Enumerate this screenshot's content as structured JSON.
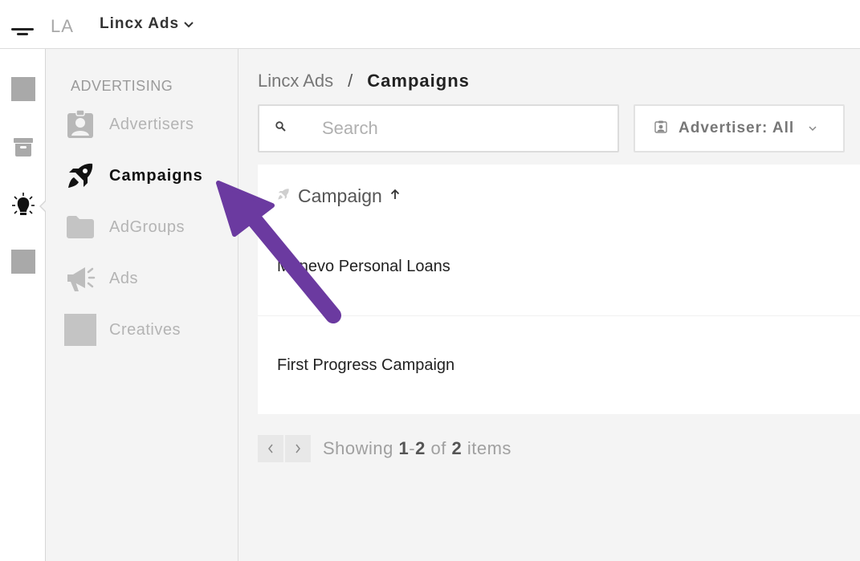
{
  "header": {
    "logo_initials": "LA",
    "app_name": "Lincx Ads",
    "menu_icon": "hamburger-icon"
  },
  "rail": {
    "items": [
      {
        "icon": "square-icon"
      },
      {
        "icon": "box-icon"
      },
      {
        "icon": "lightbulb-icon",
        "active": true
      },
      {
        "icon": "square-icon"
      }
    ]
  },
  "subnav": {
    "heading": "ADVERTISING",
    "items": [
      {
        "label": "Advertisers",
        "icon": "contact-card-icon"
      },
      {
        "label": "Campaigns",
        "icon": "rocket-icon",
        "active": true
      },
      {
        "label": "AdGroups",
        "icon": "folder-icon"
      },
      {
        "label": "Ads",
        "icon": "megaphone-icon"
      },
      {
        "label": "Creatives",
        "icon": "square-icon"
      }
    ]
  },
  "breadcrumb": {
    "root": "Lincx Ads",
    "separator": "/",
    "current": "Campaigns"
  },
  "search": {
    "placeholder": "Search",
    "value": ""
  },
  "filter": {
    "label": "Advertiser: All"
  },
  "table": {
    "column": "Campaign",
    "rows": [
      {
        "name": "Monevo Personal Loans"
      },
      {
        "name": "First Progress Campaign"
      }
    ]
  },
  "pagination": {
    "showing": "Showing",
    "range_start": "1",
    "range_sep": "-",
    "range_end": "2",
    "of": "of",
    "total": "2",
    "items": "items"
  },
  "colors": {
    "accent_arrow": "#6b3aa0",
    "sidebar_bg": "#f4f4f4",
    "inactive_text": "#b4b4b4"
  }
}
